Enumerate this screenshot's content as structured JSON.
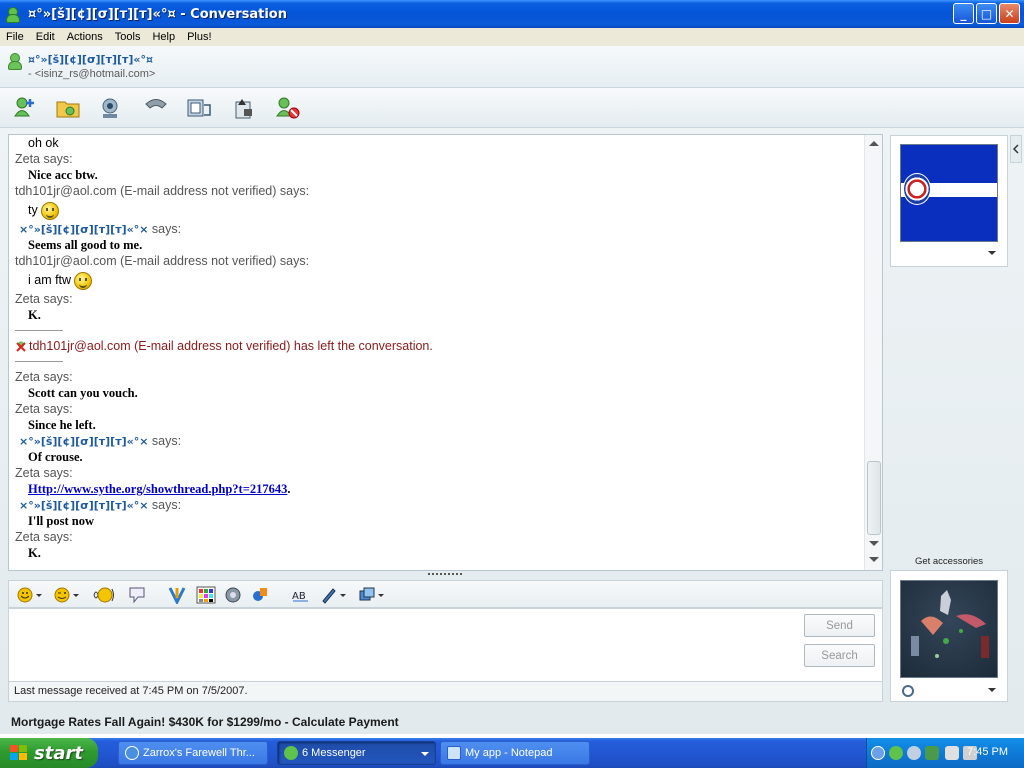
{
  "window": {
    "title": "¤°»[š][¢][σ][т][т]«°¤ - Conversation",
    "minimize": "_",
    "maximize": "□",
    "close": "✕"
  },
  "menu": [
    "File",
    "Edit",
    "Actions",
    "Tools",
    "Help",
    "Plus!"
  ],
  "contact": {
    "name": "¤°»[š][¢][σ][т][т]«°¤",
    "email": "- <isinz_rs@hotmail.com>"
  },
  "toolbar_icons": [
    "invite-contact-icon",
    "send-files-icon",
    "webcam-icon",
    "call-icon",
    "activities-icon",
    "games-icon",
    "block-icon"
  ],
  "history": {
    "lines": [
      {
        "kind": "msg-plain",
        "text": "oh ok"
      },
      {
        "kind": "says",
        "text": "Zeta says:"
      },
      {
        "kind": "msg",
        "text": "Nice acc btw."
      },
      {
        "kind": "says",
        "text": "tdh101jr@aol.com (E-mail address not verified) says:"
      },
      {
        "kind": "msg-plain-smiley",
        "text": "ty",
        "emoticon": "smile"
      },
      {
        "kind": "fancy-says",
        "name": "×°»[š][¢][σ][т][т]«°×",
        "text": " says:"
      },
      {
        "kind": "msg",
        "text": "Seems all good to me."
      },
      {
        "kind": "says",
        "text": "tdh101jr@aol.com (E-mail address not verified) says:"
      },
      {
        "kind": "msg-plain-smiley",
        "text": "i am ftw",
        "emoticon": "wink"
      },
      {
        "kind": "says",
        "text": "Zeta says:"
      },
      {
        "kind": "msg",
        "text": "K."
      },
      {
        "kind": "divider"
      },
      {
        "kind": "left",
        "text": "tdh101jr@aol.com (E-mail address not verified) has left the conversation."
      },
      {
        "kind": "divider"
      },
      {
        "kind": "says",
        "text": "Zeta says:"
      },
      {
        "kind": "msg",
        "text": "Scott can you vouch."
      },
      {
        "kind": "says",
        "text": "Zeta says:"
      },
      {
        "kind": "msg",
        "text": "Since he left."
      },
      {
        "kind": "fancy-says",
        "name": "×°»[š][¢][σ][т][т]«°×",
        "text": " says:"
      },
      {
        "kind": "msg",
        "text": "Of crouse."
      },
      {
        "kind": "says",
        "text": "Zeta says:"
      },
      {
        "kind": "link",
        "text": "Http://www.sythe.org/showthread.php?t=217643",
        "suffix": "."
      },
      {
        "kind": "fancy-says",
        "name": "×°»[š][¢][σ][т][т]«°×",
        "text": " says:"
      },
      {
        "kind": "msg",
        "text": "I'll post now"
      },
      {
        "kind": "says",
        "text": "Zeta says:"
      },
      {
        "kind": "msg",
        "text": "K."
      }
    ]
  },
  "compose": {
    "send_label": "Send",
    "search_label": "Search",
    "input_value": ""
  },
  "status": {
    "last_message": "Last message received at 7:45 PM on 7/5/2007."
  },
  "ad": {
    "text": "Mortgage Rates Fall Again! $430K for $1299/mo - Calculate Payment"
  },
  "side": {
    "get_accessories": "Get accessories"
  },
  "taskbar": {
    "start_label": "start",
    "tasks": [
      {
        "label": "Zarrox's Farewell Thr...",
        "active": false
      },
      {
        "label": "6 Messenger",
        "active": true
      },
      {
        "label": "My app - Notepad",
        "active": false
      }
    ],
    "clock": "7:45 PM"
  },
  "colors": {
    "title_blue": "#0454d6",
    "link": "#0000cc",
    "left_text": "#8b1a1a",
    "fancy_name": "#1c5a9c"
  }
}
